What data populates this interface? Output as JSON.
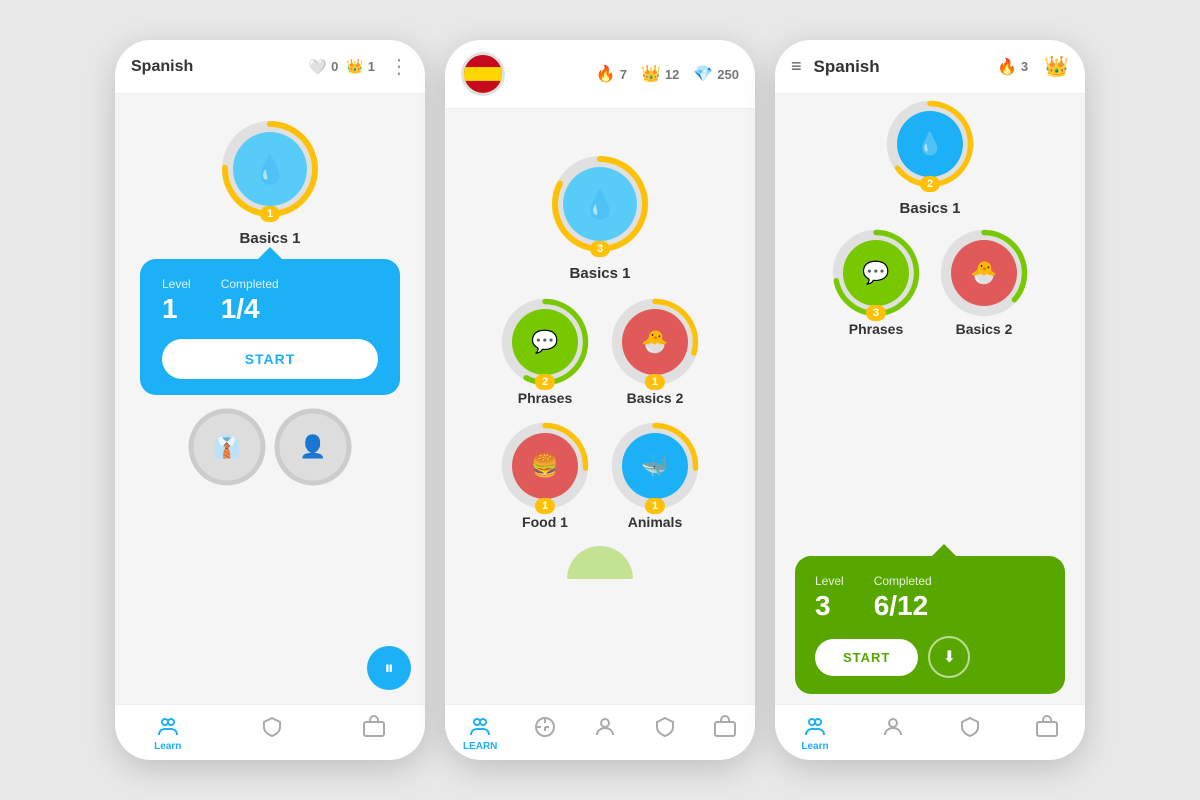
{
  "phone1": {
    "title": "Spanish",
    "stats": {
      "hearts": "0",
      "crowns": "1"
    },
    "skill": {
      "name": "Basics 1",
      "level": "1",
      "completed": "1/4",
      "crown": "1"
    },
    "popup": {
      "level_label": "Level",
      "completed_label": "Completed",
      "level_value": "1",
      "completed_value": "1/4",
      "start_btn": "START"
    },
    "nav": {
      "learn": "Learn",
      "practice": "",
      "profile": "",
      "league": "",
      "shop": ""
    }
  },
  "phone2": {
    "stats": {
      "flame": "7",
      "crown": "12",
      "gems": "250"
    },
    "skills": [
      {
        "name": "Basics 1",
        "crown": "3",
        "color": "blue",
        "icon": "💧"
      },
      {
        "name": "Phrases",
        "crown": "2",
        "color": "green",
        "icon": "💬"
      },
      {
        "name": "Basics 2",
        "crown": "1",
        "color": "red",
        "icon": "🐣"
      },
      {
        "name": "Food 1",
        "crown": "1",
        "color": "red",
        "icon": "🍔"
      },
      {
        "name": "Animals",
        "crown": "1",
        "color": "blue",
        "icon": "🐳"
      }
    ],
    "nav": {
      "learn": "LEARN",
      "practice": "",
      "profile": "",
      "league": "",
      "shop": ""
    }
  },
  "phone3": {
    "title": "Spanish",
    "stats": {
      "flame": "3",
      "crown": ""
    },
    "skills": [
      {
        "name": "Basics 1",
        "crown": "2",
        "color": "blue",
        "icon": "💧"
      },
      {
        "name": "Phrases",
        "crown": "3",
        "color": "green",
        "icon": "💬"
      },
      {
        "name": "Basics 2",
        "crown": "0",
        "color": "red",
        "icon": "🐣"
      }
    ],
    "popup": {
      "level_label": "Level",
      "completed_label": "Completed",
      "level_value": "3",
      "completed_value": "6/12",
      "start_btn": "START",
      "download_icon": "⬇"
    },
    "nav": {
      "learn": "Learn",
      "profile": "",
      "league": "",
      "shop": ""
    }
  }
}
